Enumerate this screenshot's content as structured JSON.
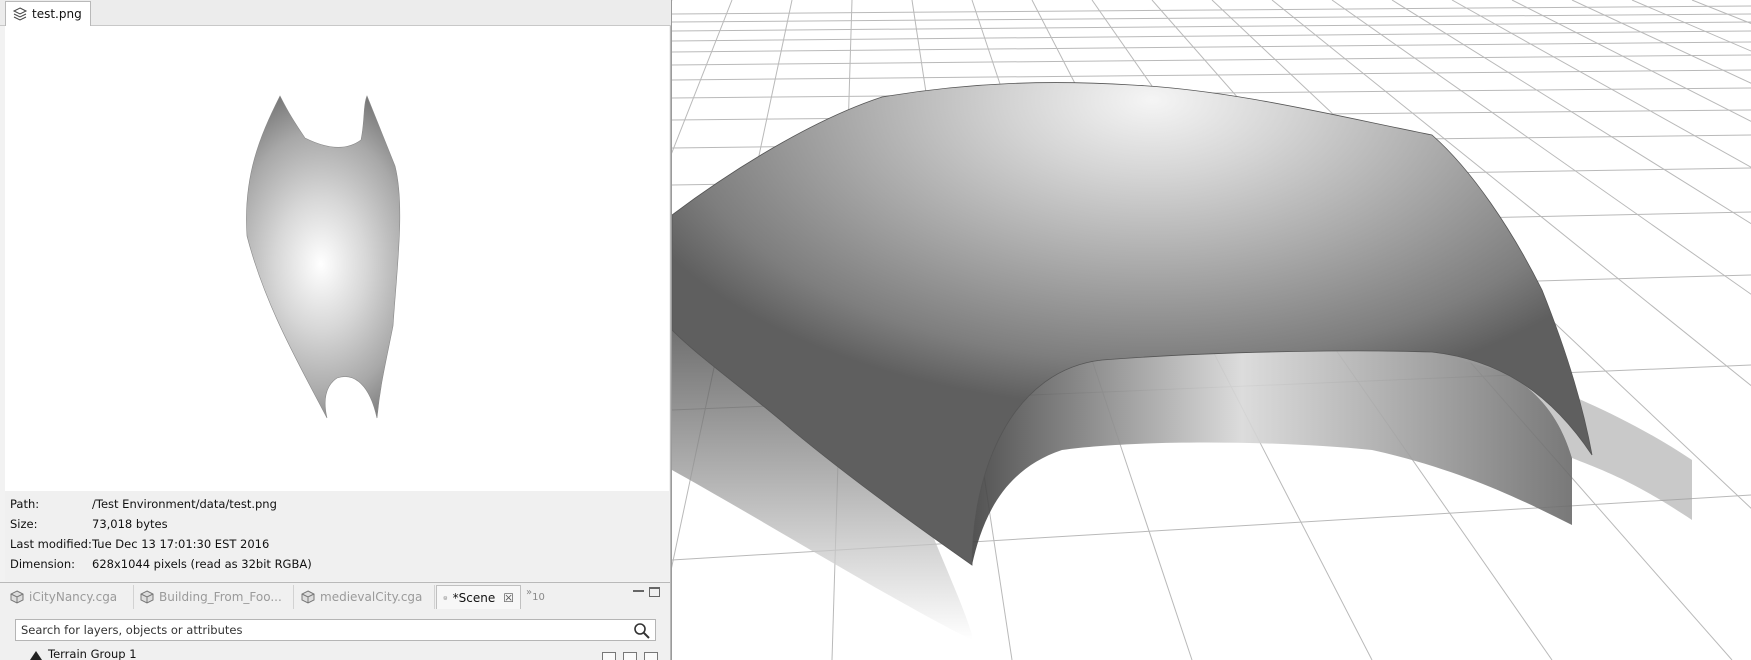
{
  "inspector": {
    "tab_title": "test.png",
    "tab_icon": "layers-icon",
    "meta": [
      {
        "label": "Path:",
        "value": "/Test Environment/data/test.png"
      },
      {
        "label": "Size:",
        "value": "73,018 bytes"
      },
      {
        "label": "Last modified:",
        "value": "Tue Dec 13 17:01:30 EST 2016"
      },
      {
        "label": "Dimension:",
        "value": "628x1044 pixels (read as 32bit RGBA)"
      }
    ]
  },
  "scene_panel": {
    "tabs": [
      {
        "label": "iCityNancy.cga",
        "icon": "cga-rule-icon",
        "active": false
      },
      {
        "label": "Building_From_Foo...",
        "icon": "cga-rule-icon",
        "active": false
      },
      {
        "label": "medievalCity.cga",
        "icon": "cga-rule-icon",
        "active": false
      },
      {
        "label": "*Scene",
        "icon": "layers-icon",
        "active": true
      }
    ],
    "overflow": {
      "chevron": "»",
      "count": "10"
    },
    "search": {
      "placeholder": "Search for layers, objects or attributes",
      "value": ""
    },
    "tree_first_item": "Terrain Group 1"
  },
  "viewport": {
    "content": "3D terrain heightmap over ground grid",
    "colors": {
      "grid": "#b5b5b5",
      "surface_light": "#f2f2f2",
      "surface_dark": "#6a6a6a"
    }
  }
}
